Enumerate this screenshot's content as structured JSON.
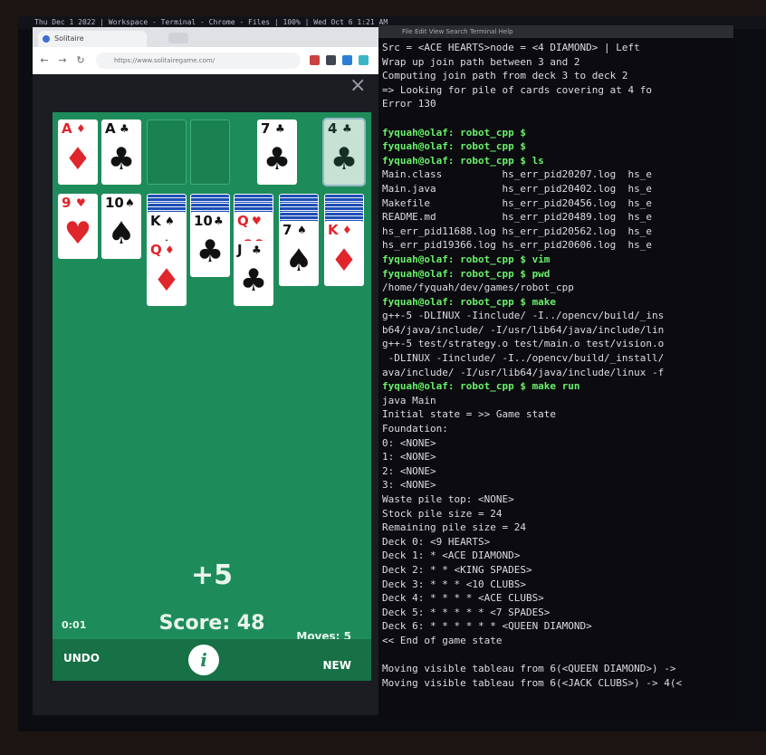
{
  "os_bar": {
    "text": "Thu Dec 1 2022 | Workspace - Terminal - Chrome - Files | 100% | Wed Oct 6 1:21 AM"
  },
  "browser": {
    "tab_title": "Solitaire",
    "url": "https://www.solitairegame.com/",
    "close_label": "×"
  },
  "game": {
    "foundation": [
      {
        "rank": "A",
        "suit": "♦",
        "color": "red"
      },
      {
        "rank": "A",
        "suit": "♣",
        "color": "black"
      }
    ],
    "waste": {
      "rank": "7",
      "suit": "♣",
      "color": "black"
    },
    "stock_top": {
      "rank": "4",
      "suit": "♣",
      "color": "black"
    },
    "tableau": [
      {
        "backs": 0,
        "face": [
          {
            "rank": "9",
            "suit": "♥",
            "color": "red"
          }
        ]
      },
      {
        "backs": 0,
        "face": [
          {
            "rank": "10",
            "suit": "♠",
            "color": "black"
          }
        ]
      },
      {
        "backs": 2,
        "face": [
          {
            "rank": "K",
            "suit": "♠",
            "color": "black"
          },
          {
            "rank": "Q",
            "suit": "♦",
            "color": "red"
          }
        ]
      },
      {
        "backs": 2,
        "face": [
          {
            "rank": "10",
            "suit": "♣",
            "color": "black"
          }
        ]
      },
      {
        "backs": 2,
        "face": [
          {
            "rank": "Q",
            "suit": "♥",
            "color": "red"
          },
          {
            "rank": "J",
            "suit": "♣",
            "color": "black"
          }
        ]
      },
      {
        "backs": 3,
        "face": [
          {
            "rank": "7",
            "suit": "♠",
            "color": "black"
          }
        ]
      },
      {
        "backs": 3,
        "face": [
          {
            "rank": "K",
            "suit": "♦",
            "color": "red"
          }
        ]
      }
    ],
    "bonus": "+5",
    "timer": "0:01",
    "score": "Score: 48",
    "moves": "Moves: 5",
    "undo": "UNDO",
    "info": "i",
    "new": "NEW"
  },
  "terminal": {
    "title": "File  Edit  View  Search  Terminal  Help",
    "lines": [
      {
        "t": "Src = <ACE HEARTS>node = <4 DIAMOND> | Left",
        "c": "w"
      },
      {
        "t": "Wrap up join path between 3 and 2",
        "c": "w"
      },
      {
        "t": "Computing join path from deck 3 to deck 2",
        "c": "w"
      },
      {
        "t": "=> Looking for pile of cards covering at 4 fo",
        "c": "w"
      },
      {
        "t": "Error 130",
        "c": "w"
      },
      {
        "t": "",
        "c": "w"
      },
      {
        "t": "fyquah@olaf: robot_cpp $",
        "c": "g"
      },
      {
        "t": "fyquah@olaf: robot_cpp $",
        "c": "g"
      },
      {
        "t": "fyquah@olaf: robot_cpp $ ls",
        "c": "g"
      },
      {
        "t": "Main.class          hs_err_pid20207.log  hs_e",
        "c": "w"
      },
      {
        "t": "Main.java           hs_err_pid20402.log  hs_e",
        "c": "w"
      },
      {
        "t": "Makefile            hs_err_pid20456.log  hs_e",
        "c": "w"
      },
      {
        "t": "README.md           hs_err_pid20489.log  hs_e",
        "c": "w"
      },
      {
        "t": "hs_err_pid11688.log hs_err_pid20562.log  hs_e",
        "c": "w"
      },
      {
        "t": "hs_err_pid19366.log hs_err_pid20606.log  hs_e",
        "c": "w"
      },
      {
        "t": "fyquah@olaf: robot_cpp $ vim",
        "c": "g"
      },
      {
        "t": "fyquah@olaf: robot_cpp $ pwd",
        "c": "g"
      },
      {
        "t": "/home/fyquah/dev/games/robot_cpp",
        "c": "w"
      },
      {
        "t": "fyquah@olaf: robot_cpp $ make",
        "c": "g"
      },
      {
        "t": "g++-5 -DLINUX -Iinclude/ -I../opencv/build/_ins",
        "c": "w"
      },
      {
        "t": "b64/java/include/ -I/usr/lib64/java/include/lin",
        "c": "w"
      },
      {
        "t": "g++-5 test/strategy.o test/main.o test/vision.o",
        "c": "w"
      },
      {
        "t": " -DLINUX -Iinclude/ -I../opencv/build/_install/",
        "c": "w"
      },
      {
        "t": "ava/include/ -I/usr/lib64/java/include/linux -f",
        "c": "w"
      },
      {
        "t": "fyquah@olaf: robot_cpp $ make run",
        "c": "g"
      },
      {
        "t": "java Main",
        "c": "w"
      },
      {
        "t": "Initial state = >> Game state",
        "c": "w"
      },
      {
        "t": "Foundation:",
        "c": "w"
      },
      {
        "t": "0: <NONE>",
        "c": "w"
      },
      {
        "t": "1: <NONE>",
        "c": "w"
      },
      {
        "t": "2: <NONE>",
        "c": "w"
      },
      {
        "t": "3: <NONE>",
        "c": "w"
      },
      {
        "t": "Waste pile top: <NONE>",
        "c": "w"
      },
      {
        "t": "Stock pile size = 24",
        "c": "w"
      },
      {
        "t": "Remaining pile size = 24",
        "c": "w"
      },
      {
        "t": "Deck 0: <9 HEARTS>",
        "c": "w"
      },
      {
        "t": "Deck 1: * <ACE DIAMOND>",
        "c": "w"
      },
      {
        "t": "Deck 2: * * <KING SPADES>",
        "c": "w"
      },
      {
        "t": "Deck 3: * * * <10 CLUBS>",
        "c": "w"
      },
      {
        "t": "Deck 4: * * * * <ACE CLUBS>",
        "c": "w"
      },
      {
        "t": "Deck 5: * * * * * <7 SPADES>",
        "c": "w"
      },
      {
        "t": "Deck 6: * * * * * * <QUEEN DIAMOND>",
        "c": "w"
      },
      {
        "t": "<< End of game state",
        "c": "w"
      },
      {
        "t": "",
        "c": "w"
      },
      {
        "t": "Moving visible tableau from 6(<QUEEN DIAMOND>) ->",
        "c": "w"
      },
      {
        "t": "Moving visible tableau from 6(<JACK CLUBS>) -> 4(<",
        "c": "w"
      }
    ]
  }
}
